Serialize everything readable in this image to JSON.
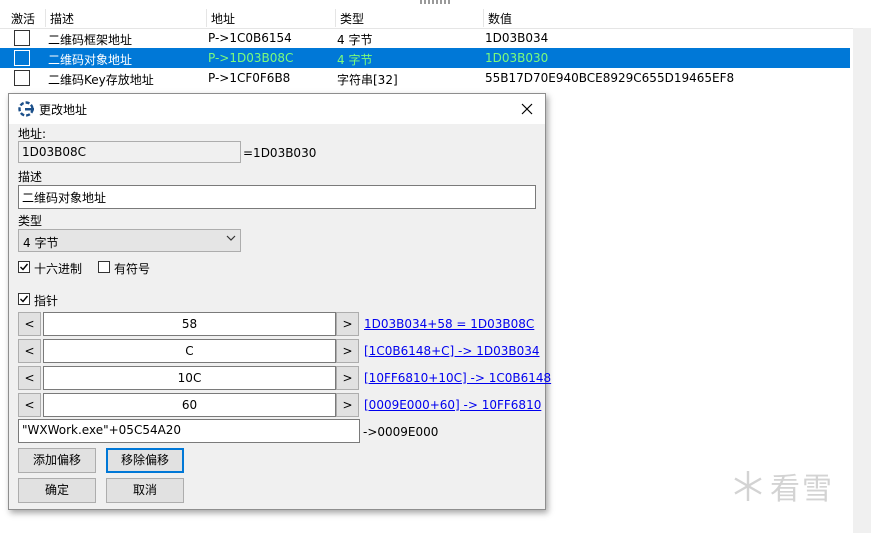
{
  "list": {
    "columns": {
      "active": "激活",
      "description": "描述",
      "address": "地址",
      "type": "类型",
      "value": "数值"
    },
    "rows": [
      {
        "description": "二维码框架地址",
        "address": "P->1C0B6154",
        "type": "4 字节",
        "value": "1D03B034"
      },
      {
        "description": "二维码对象地址",
        "address": "P->1D03B08C",
        "type": "4 字节",
        "value": "1D03B030"
      },
      {
        "description": "二维码Key存放地址",
        "address": "P->1CF0F6B8",
        "type": "字符串[32]",
        "value": "55B17D70E940BCE8929C655D19465EF8"
      }
    ]
  },
  "watermark": "看雪",
  "dialog": {
    "title": "更改地址",
    "address_label": "地址:",
    "address_value": "1D03B08C",
    "address_result": "=1D03B030",
    "description_label": "描述",
    "description_value": "二维码对象地址",
    "type_label": "类型",
    "type_value": "4 字节",
    "hex_label": "十六进制",
    "hex_checked": true,
    "signed_label": "有符号",
    "signed_checked": false,
    "pointer_label": "指针",
    "pointer_checked": true,
    "offsets": [
      {
        "value": "58",
        "link": "1D03B034+58 = 1D03B08C"
      },
      {
        "value": "C",
        "link": "[1C0B6148+C] -> 1D03B034"
      },
      {
        "value": "10C",
        "link": "[10FF6810+10C] -> 1C0B6148"
      },
      {
        "value": "60",
        "link": "[0009E000+60] -> 10FF6810"
      }
    ],
    "base_value": "\"WXWork.exe\"+05C54A20",
    "base_result": "->0009E000",
    "dec_button": "<",
    "inc_button": ">",
    "add_offset_button": "添加偏移",
    "remove_offset_button": "移除偏移",
    "ok_button": "确定",
    "cancel_button": "取消"
  }
}
